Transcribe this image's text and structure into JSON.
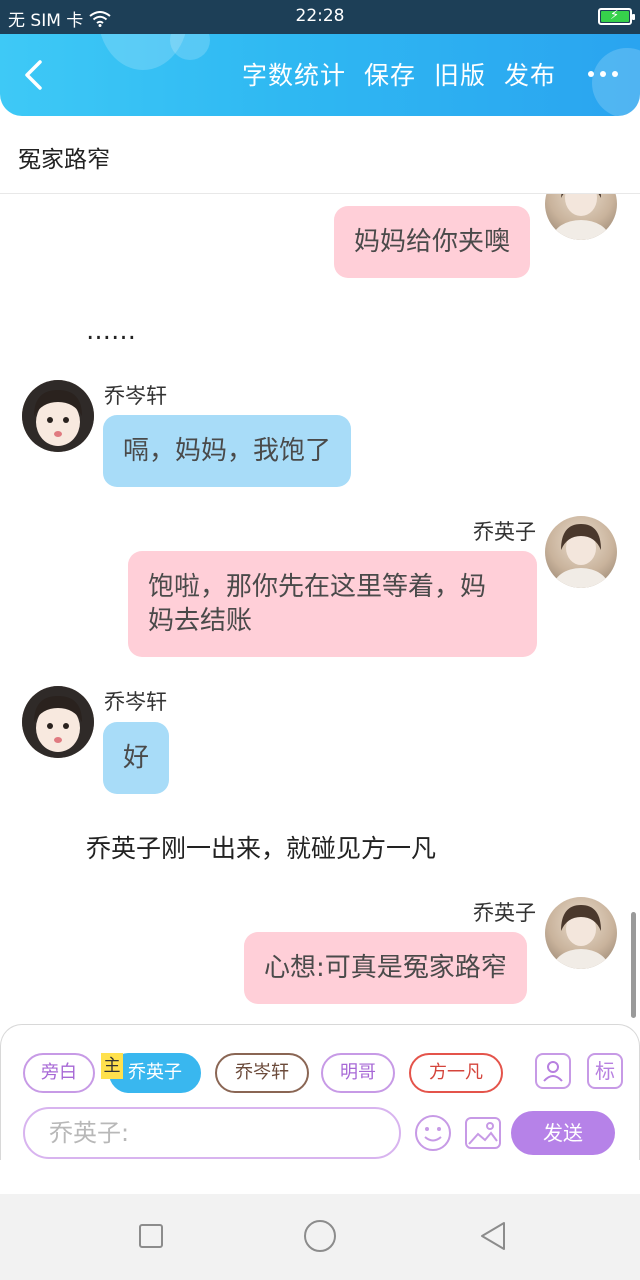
{
  "status_bar": {
    "carrier": "无 SIM 卡",
    "time": "22:28"
  },
  "header": {
    "actions": [
      "字数统计",
      "保存",
      "旧版",
      "发布"
    ]
  },
  "title": "冤家路窄",
  "chat": {
    "msg1": {
      "text": "妈妈给你夹噢"
    },
    "narration1": "……",
    "msg2": {
      "name": "乔岑轩",
      "text": "嗝，妈妈，我饱了"
    },
    "msg3": {
      "name": "乔英子",
      "line1": "饱啦，那你先在这里等着，妈",
      "line2": "妈去结账"
    },
    "msg4": {
      "name": "乔岑轩",
      "text": "好"
    },
    "narration2": "乔英子刚一出来，就碰见方一凡",
    "msg5": {
      "name": "乔英子",
      "text": "心想:可真是冤家路窄"
    }
  },
  "input": {
    "roles": {
      "aside": "旁白",
      "main_tag": "主",
      "yingzi": "乔英子",
      "cenxuan": "乔岑轩",
      "mingge": "明哥",
      "fangyifan": "方一凡"
    },
    "tag_button": "标",
    "placeholder": "乔英子:",
    "send": "发送"
  }
}
